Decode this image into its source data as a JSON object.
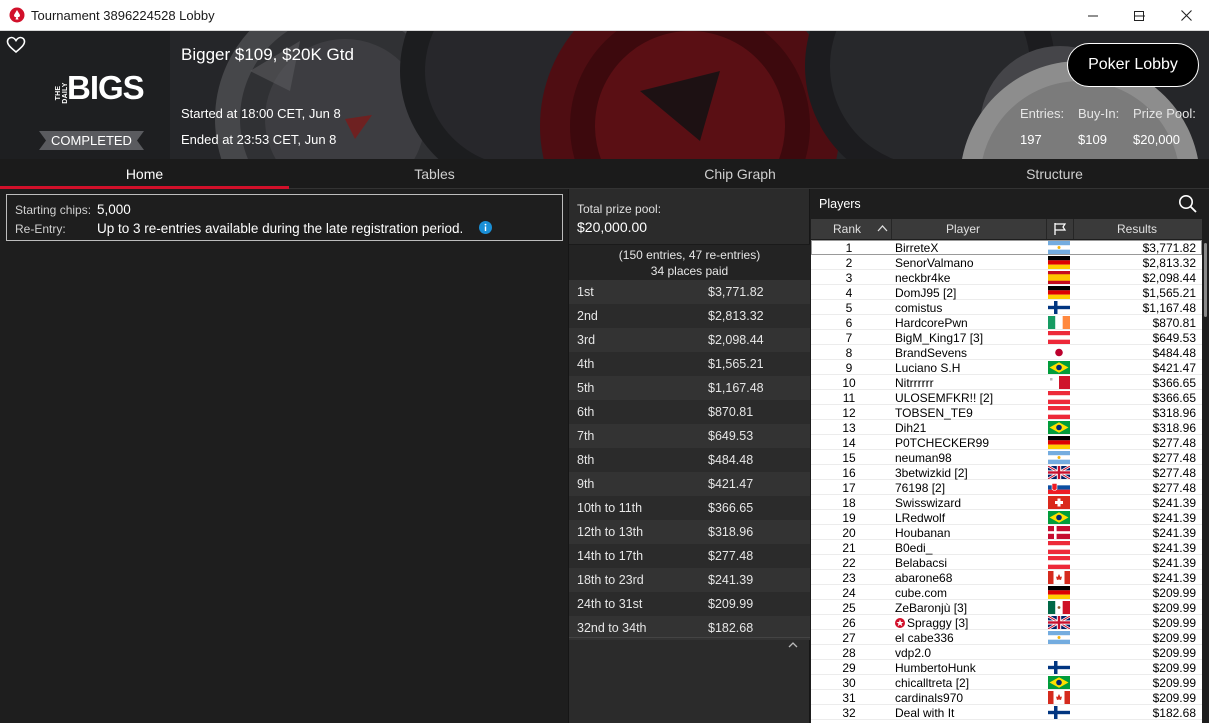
{
  "window": {
    "title": "Tournament 3896224528 Lobby"
  },
  "banner": {
    "tournament_name": "Bigger $109, $20K Gtd",
    "started": "Started at 18:00 CET, Jun 8",
    "ended": "Ended at 23:53 CET, Jun 8",
    "status": "COMPLETED",
    "logo_small": "THE DAILY",
    "logo_big": "BIGS",
    "poker_lobby_label": "Poker Lobby",
    "stats": [
      {
        "label": "Entries:",
        "value": "197"
      },
      {
        "label": "Buy-In:",
        "value": "$109"
      },
      {
        "label": "Prize Pool:",
        "value": "$20,000"
      }
    ]
  },
  "tabs": [
    {
      "label": "Home",
      "active": true
    },
    {
      "label": "Tables",
      "active": false
    },
    {
      "label": "Chip Graph",
      "active": false
    },
    {
      "label": "Structure",
      "active": false
    }
  ],
  "home": {
    "starting_chips_label": "Starting chips:",
    "starting_chips_value": "5,000",
    "reentry_label": "Re-Entry:",
    "reentry_value": "Up to 3 re-entries available during the late registration period."
  },
  "prize": {
    "total_label": "Total prize pool:",
    "total_value": "$20,000.00",
    "entries_line": "(150 entries, 47 re-entries)",
    "places_line": "34 places paid",
    "payouts": [
      {
        "place": "1st",
        "amount": "$3,771.82"
      },
      {
        "place": "2nd",
        "amount": "$2,813.32"
      },
      {
        "place": "3rd",
        "amount": "$2,098.44"
      },
      {
        "place": "4th",
        "amount": "$1,565.21"
      },
      {
        "place": "5th",
        "amount": "$1,167.48"
      },
      {
        "place": "6th",
        "amount": "$870.81"
      },
      {
        "place": "7th",
        "amount": "$649.53"
      },
      {
        "place": "8th",
        "amount": "$484.48"
      },
      {
        "place": "9th",
        "amount": "$421.47"
      },
      {
        "place": "10th to 11th",
        "amount": "$366.65"
      },
      {
        "place": "12th to 13th",
        "amount": "$318.96"
      },
      {
        "place": "14th to 17th",
        "amount": "$277.48"
      },
      {
        "place": "18th to 23rd",
        "amount": "$241.39"
      },
      {
        "place": "24th to 31st",
        "amount": "$209.99"
      },
      {
        "place": "32nd to 34th",
        "amount": "$182.68"
      }
    ]
  },
  "players": {
    "title": "Players",
    "columns": {
      "rank": "Rank",
      "player": "Player",
      "results": "Results"
    },
    "rows": [
      {
        "rank": "1",
        "name": "BirreteX",
        "flag": "argentina",
        "result": "$3,771.82"
      },
      {
        "rank": "2",
        "name": "SenorValmano",
        "flag": "germany",
        "result": "$2,813.32"
      },
      {
        "rank": "3",
        "name": "neckbr4ke",
        "flag": "spain",
        "result": "$2,098.44"
      },
      {
        "rank": "4",
        "name": "DomJ95 [2]",
        "flag": "germany",
        "result": "$1,565.21"
      },
      {
        "rank": "5",
        "name": "comistus",
        "flag": "finland",
        "result": "$1,167.48"
      },
      {
        "rank": "6",
        "name": "HardcorePwn",
        "flag": "ireland",
        "result": "$870.81"
      },
      {
        "rank": "7",
        "name": "BigM_King17 [3]",
        "flag": "austria",
        "result": "$649.53"
      },
      {
        "rank": "8",
        "name": "BrandSevens",
        "flag": "japan",
        "result": "$484.48"
      },
      {
        "rank": "9",
        "name": "Luciano S.H",
        "flag": "brazil",
        "result": "$421.47"
      },
      {
        "rank": "10",
        "name": "Nitrrrrrr",
        "flag": "malta",
        "result": "$366.65"
      },
      {
        "rank": "11",
        "name": "ULOSEMFKR!! [2]",
        "flag": "austria",
        "result": "$366.65"
      },
      {
        "rank": "12",
        "name": "TOBSEN_TE9",
        "flag": "austria",
        "result": "$318.96"
      },
      {
        "rank": "13",
        "name": "Dih21",
        "flag": "brazil",
        "result": "$318.96"
      },
      {
        "rank": "14",
        "name": "P0TCHECKER99",
        "flag": "germany",
        "result": "$277.48"
      },
      {
        "rank": "15",
        "name": "neuman98",
        "flag": "argentina",
        "result": "$277.48"
      },
      {
        "rank": "16",
        "name": "3betwizkid [2]",
        "flag": "uk",
        "result": "$277.48"
      },
      {
        "rank": "17",
        "name": "76198 [2]",
        "flag": "slovakia",
        "result": "$277.48"
      },
      {
        "rank": "18",
        "name": "Swisswizard",
        "flag": "switzerland",
        "result": "$241.39"
      },
      {
        "rank": "19",
        "name": "LRedwolf",
        "flag": "brazil",
        "result": "$241.39"
      },
      {
        "rank": "20",
        "name": "Houbanan",
        "flag": "denmark",
        "result": "$241.39"
      },
      {
        "rank": "21",
        "name": "B0edi_",
        "flag": "austria",
        "result": "$241.39"
      },
      {
        "rank": "22",
        "name": "Belabacsi",
        "flag": "austria",
        "result": "$241.39"
      },
      {
        "rank": "23",
        "name": "abarone68",
        "flag": "canada",
        "result": "$241.39"
      },
      {
        "rank": "24",
        "name": "cube.com",
        "flag": "germany",
        "result": "$209.99"
      },
      {
        "rank": "25",
        "name": "ZeBaronjù [3]",
        "flag": "mexico",
        "result": "$209.99"
      },
      {
        "rank": "26",
        "name": "Spraggy [3]",
        "flag": "uk",
        "result": "$209.99",
        "star": true
      },
      {
        "rank": "27",
        "name": "el cabe336",
        "flag": "argentina",
        "result": "$209.99"
      },
      {
        "rank": "28",
        "name": "vdp2.0",
        "flag": "none",
        "result": "$209.99"
      },
      {
        "rank": "29",
        "name": "HumbertoHunk",
        "flag": "finland",
        "result": "$209.99"
      },
      {
        "rank": "30",
        "name": "chicalltreta [2]",
        "flag": "brazil",
        "result": "$209.99"
      },
      {
        "rank": "31",
        "name": "cardinals970",
        "flag": "canada",
        "result": "$209.99"
      },
      {
        "rank": "32",
        "name": "Deal with It",
        "flag": "finland",
        "result": "$182.68"
      }
    ]
  },
  "colors": {
    "accent": "#d1102a",
    "background": "#1e1e1e",
    "panel": "#2b2b2b",
    "info_icon": "#1a8fd6"
  },
  "icons": {
    "favorite": "heart-icon",
    "search": "search-icon",
    "info": "info-icon",
    "flag_column": "flag-icon",
    "sort": "sort-up-icon",
    "collapse": "chevron-up-icon",
    "app": "pokerstars-spade-icon"
  }
}
